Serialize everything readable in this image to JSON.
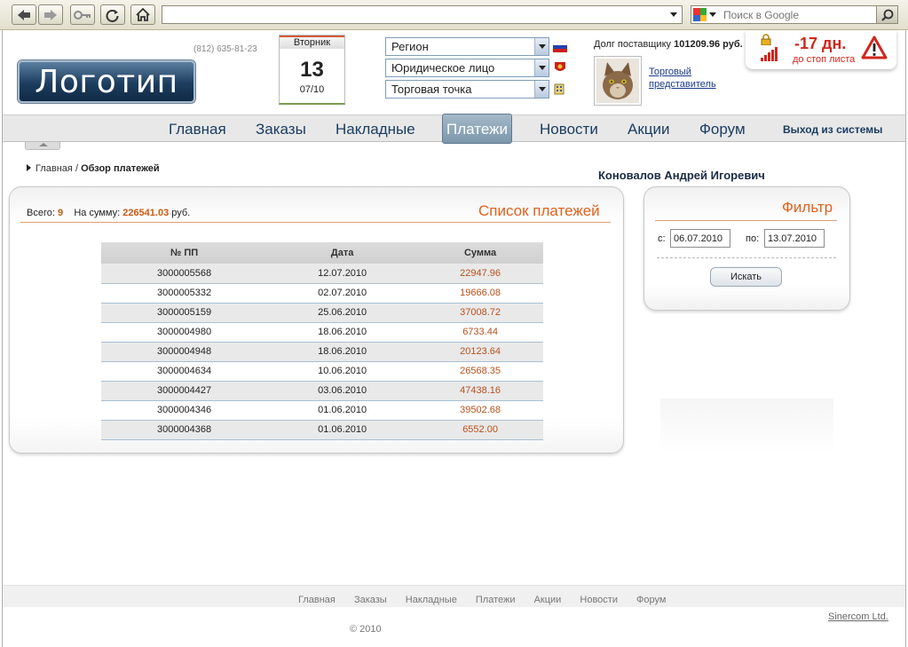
{
  "browser": {
    "address_value": "",
    "search_placeholder": "Поиск в Google"
  },
  "header": {
    "logo_text": "Логотип",
    "phone": "(812) 635-81-23",
    "calendar": {
      "weekday": "Вторник",
      "day": "13",
      "month": "07/10"
    },
    "selects": [
      {
        "value": "Регион",
        "flag": "russia-flag-icon"
      },
      {
        "value": "Юридическое лицо",
        "flag": "coat-of-arms-icon"
      },
      {
        "value": "Торговая точка",
        "flag": "building-icon"
      }
    ],
    "debt_label": "Долг поставщику",
    "debt_value": "101209.96 руб.",
    "rep_line1": "Торговый",
    "rep_line2": "представитель",
    "alert": {
      "days": "-17 дн.",
      "subtitle": "до стоп листа"
    }
  },
  "nav": {
    "items": [
      "Главная",
      "Заказы",
      "Накладные",
      "Платежи",
      "Новости",
      "Акции",
      "Форум"
    ],
    "active": "Платежи",
    "logout": "Выход из системы"
  },
  "breadcrumb": {
    "home": "Главная",
    "separator": "/",
    "current": "Обзор платежей"
  },
  "user_name": "Коновалов Андрей Игоревич",
  "payments": {
    "title": "Список платежей",
    "total_label": "Всего:",
    "total_value": "9",
    "sum_label": "На сумму:",
    "sum_value": "226541.03",
    "sum_unit": "руб.",
    "columns": [
      "№ ПП",
      "Дата",
      "Сумма"
    ],
    "rows": [
      [
        "3000005568",
        "12.07.2010",
        "22947.96"
      ],
      [
        "3000005332",
        "02.07.2010",
        "19666.08"
      ],
      [
        "3000005159",
        "25.06.2010",
        "37008.72"
      ],
      [
        "3000004980",
        "18.06.2010",
        "6733.44"
      ],
      [
        "3000004948",
        "18.06.2010",
        "20123.64"
      ],
      [
        "3000004634",
        "10.06.2010",
        "26568.35"
      ],
      [
        "3000004427",
        "03.06.2010",
        "47438.16"
      ],
      [
        "3000004346",
        "01.06.2010",
        "39502.68"
      ],
      [
        "3000004368",
        "01.06.2010",
        "6552.00"
      ]
    ]
  },
  "filter": {
    "title": "Фильтр",
    "from_label": "с:",
    "from_value": "06.07.2010",
    "to_label": "по:",
    "to_value": "13.07.2010",
    "button": "Искать"
  },
  "footer": {
    "links": [
      "Главная",
      "Заказы",
      "Накладные",
      "Платежи",
      "Акции",
      "Новости",
      "Форум"
    ],
    "copyright": "© 2010",
    "credit": "Sinercom Ltd."
  },
  "colors": {
    "accent": "#e2611b",
    "nav_text": "#1a3d63",
    "alert": "#d0261c"
  }
}
